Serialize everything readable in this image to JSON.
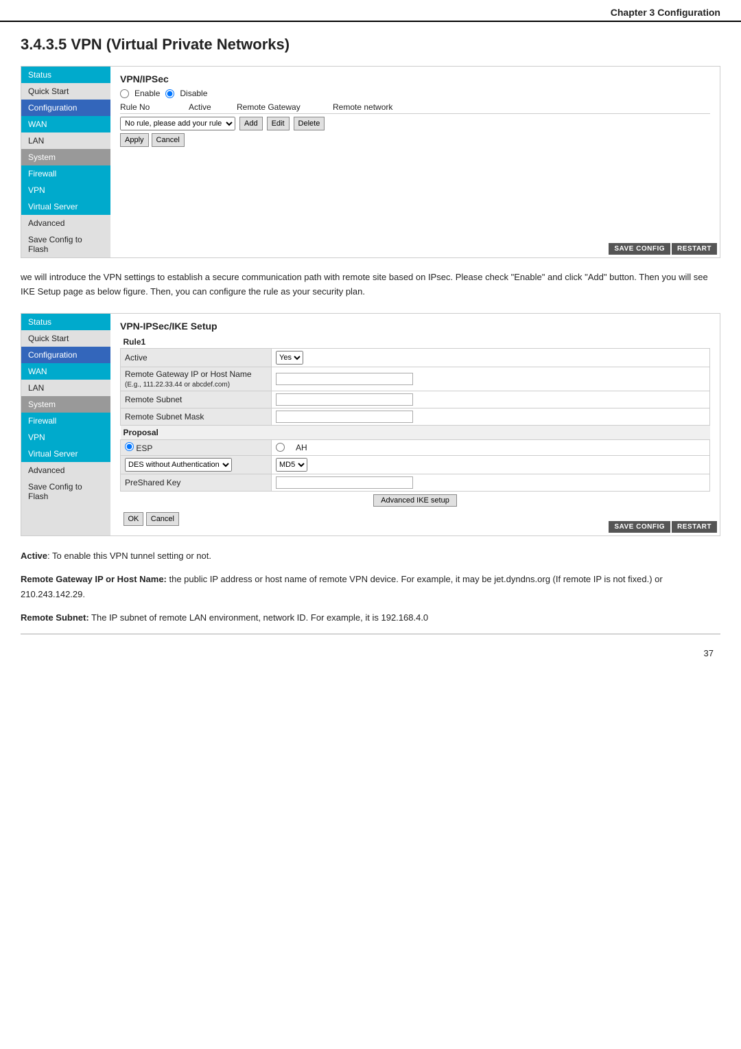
{
  "header": {
    "title": "Chapter 3 Configuration"
  },
  "section_title": "3.4.3.5 VPN (Virtual Private Networks)",
  "vpn_box": {
    "panel_title": "VPN/IPSec",
    "enable_label": "Enable",
    "disable_label": "Disable",
    "table_headers": [
      "Rule No",
      "Active",
      "Remote Gateway",
      "Remote network"
    ],
    "rule_dropdown_placeholder": "No rule, please add your rule",
    "buttons": {
      "add": "Add",
      "edit": "Edit",
      "delete": "Delete",
      "apply": "Apply",
      "cancel": "Cancel"
    },
    "footer_buttons": [
      "SAVE CONFIG",
      "RESTART"
    ]
  },
  "sidebar_items": [
    {
      "label": "Status",
      "style": "active-cyan"
    },
    {
      "label": "Quick Start",
      "style": "normal"
    },
    {
      "label": "Configuration",
      "style": "active-blue"
    },
    {
      "label": "WAN",
      "style": "active-cyan"
    },
    {
      "label": "LAN",
      "style": "normal"
    },
    {
      "label": "System",
      "style": "active-gray"
    },
    {
      "label": "Firewall",
      "style": "active-cyan"
    },
    {
      "label": "VPN",
      "style": "active-cyan"
    },
    {
      "label": "Virtual Server",
      "style": "active-cyan"
    },
    {
      "label": "Advanced",
      "style": "normal"
    },
    {
      "label": "Save Config to Flash",
      "style": "normal"
    }
  ],
  "sidebar_items2": [
    {
      "label": "Status",
      "style": "active-cyan"
    },
    {
      "label": "Quick Start",
      "style": "normal"
    },
    {
      "label": "Configuration",
      "style": "active-blue"
    },
    {
      "label": "WAN",
      "style": "active-cyan"
    },
    {
      "label": "LAN",
      "style": "normal"
    },
    {
      "label": "System",
      "style": "active-gray"
    },
    {
      "label": "Firewall",
      "style": "active-cyan"
    },
    {
      "label": "VPN",
      "style": "active-cyan"
    },
    {
      "label": "Virtual Server",
      "style": "active-cyan"
    },
    {
      "label": "Advanced",
      "style": "normal"
    },
    {
      "label": "Save Config to Flash",
      "style": "normal"
    }
  ],
  "description": "we will introduce the VPN settings to establish a secure communication path with remote site based on IPsec. Please check \"Enable\" and click \"Add\" button. Then you will see IKE Setup page as below figure. Then, you can configure the rule as your security plan.",
  "ike_box": {
    "panel_title": "VPN-IPSec/IKE Setup",
    "rule_label": "Rule1",
    "fields": [
      {
        "label": "Active",
        "type": "select",
        "options": [
          "Yes"
        ]
      },
      {
        "label": "Remote Gateway IP or Host Name\n(E.g., 111.22.33.44 or abcdef.com)",
        "type": "text"
      },
      {
        "label": "Remote Subnet",
        "type": "text"
      },
      {
        "label": "Remote Subnet Mask",
        "type": "text"
      }
    ],
    "proposal_label": "Proposal",
    "esp_label": "ESP",
    "ah_label": "AH",
    "enc_options": [
      "DES without Authentication"
    ],
    "hash_options": [
      "MD5"
    ],
    "preshared_key_label": "PreShared Key",
    "adv_ike_label": "Advanced IKE setup",
    "ok_btn": "OK",
    "cancel_btn": "Cancel",
    "footer_buttons": [
      "SAVE CONFIG",
      "RESTART"
    ]
  },
  "bottom_texts": [
    {
      "bold": "Active",
      "normal": ": To enable this VPN tunnel setting or not."
    },
    {
      "bold": "Remote Gateway IP or Host Name:",
      "normal": " the public IP address or host name of remote VPN device. For example, it may be jet.dyndns.org (If remote IP is not fixed.) or 210.243.142.29."
    },
    {
      "bold": "Remote Subnet:",
      "normal": " The IP subnet of remote LAN environment, network ID. For example, it is 192.168.4.0"
    }
  ],
  "page_number": "37"
}
